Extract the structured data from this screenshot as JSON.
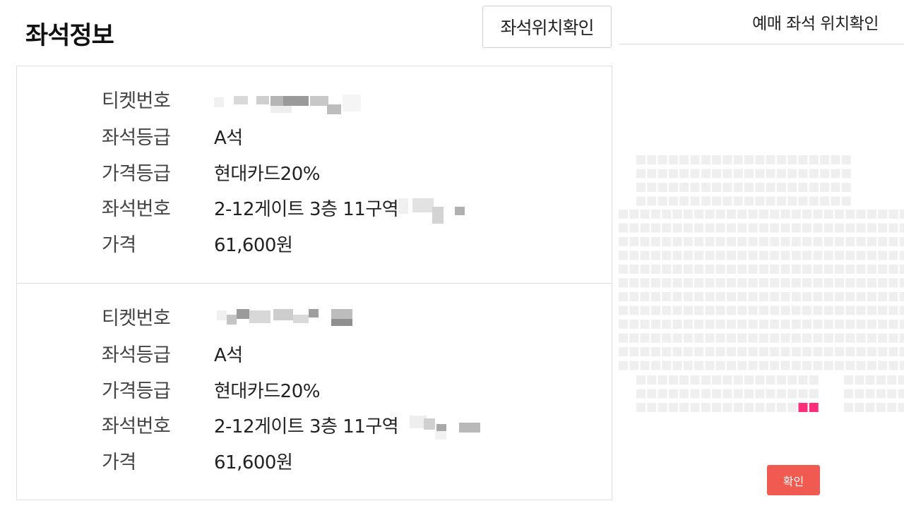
{
  "header": {
    "title": "좌석정보",
    "seat_location_button": "좌석위치확인"
  },
  "tickets": [
    {
      "rows": [
        {
          "label": "티켓번호",
          "value": ""
        },
        {
          "label": "좌석등급",
          "value": "A석"
        },
        {
          "label": "가격등급",
          "value": "현대카드20%"
        },
        {
          "label": "좌석번호",
          "value": "2-12게이트 3층 11구역"
        },
        {
          "label": "가격",
          "value": "61,600원"
        }
      ]
    },
    {
      "rows": [
        {
          "label": "티켓번호",
          "value": ""
        },
        {
          "label": "좌석등급",
          "value": "A석"
        },
        {
          "label": "가격등급",
          "value": "현대카드20%"
        },
        {
          "label": "좌석번호",
          "value": "2-12게이트 3층 11구역"
        },
        {
          "label": "가격",
          "value": "61,600원"
        }
      ]
    }
  ],
  "seat_panel": {
    "title": "예매 좌석 위치확인",
    "confirm_button": "확인",
    "seat_color": "#efefef",
    "selected_color": "#ff2d7a"
  },
  "colors": {
    "confirm": "#f05a50"
  }
}
